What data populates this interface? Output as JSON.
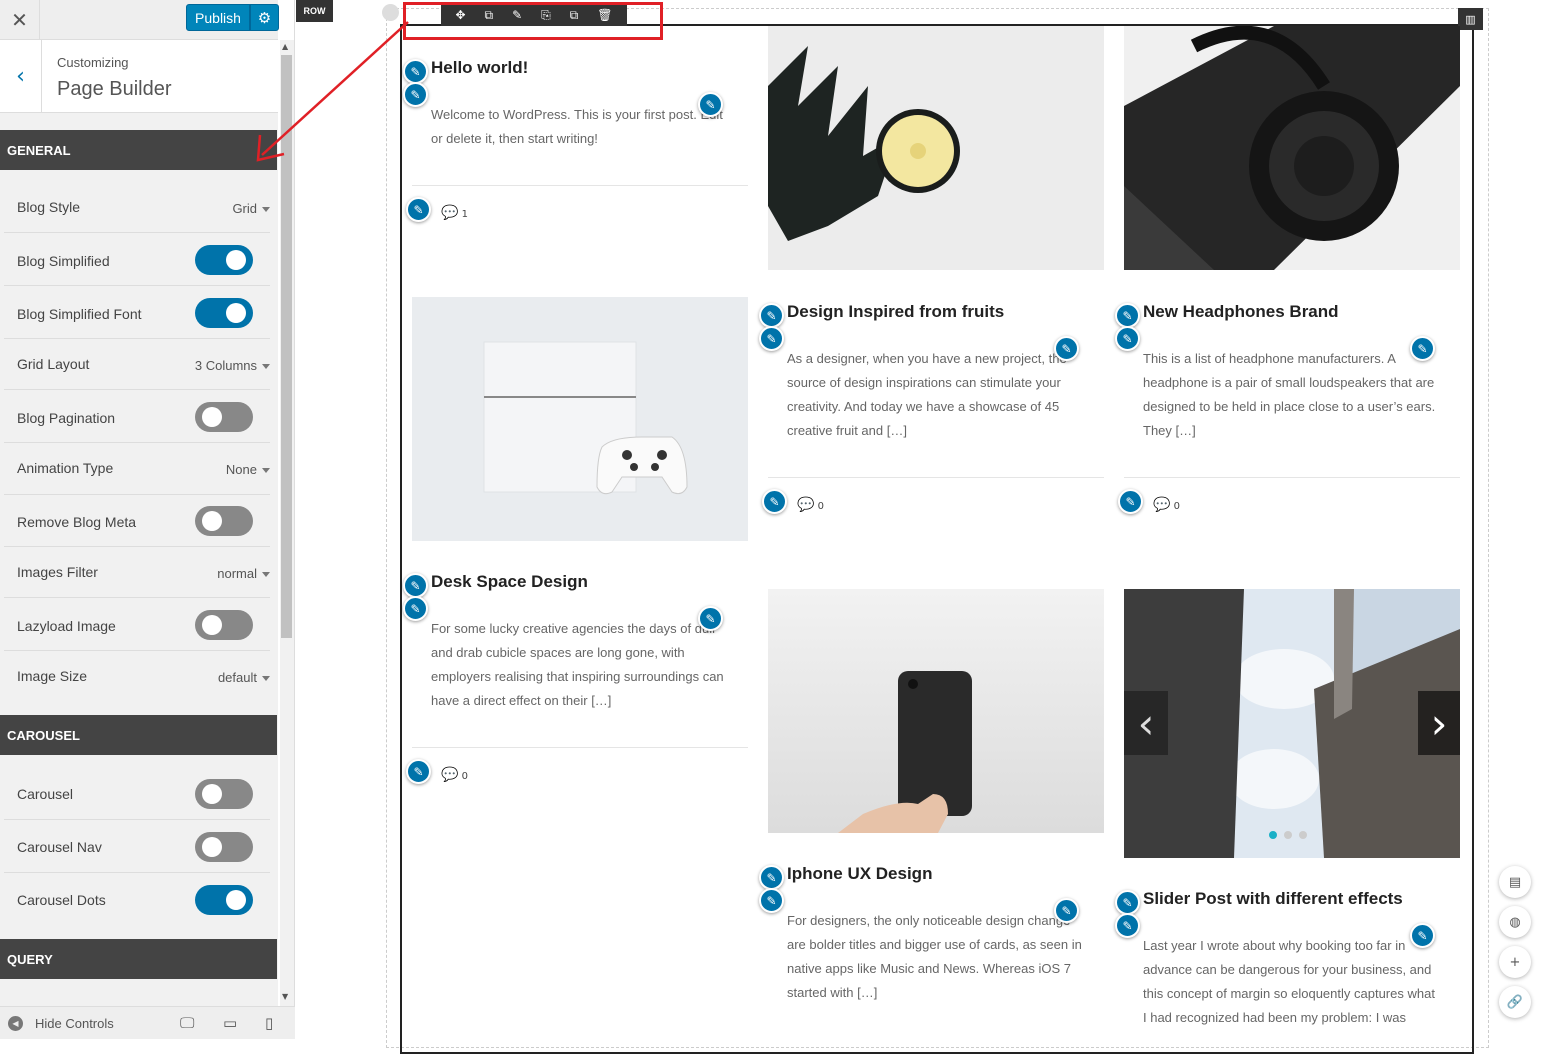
{
  "topbar": {
    "close_icon": "✕",
    "publish_label": "Publish",
    "settings_icon": "⚙"
  },
  "header": {
    "back_icon": "‹",
    "breadcrumb": "Customizing",
    "title": "Page Builder"
  },
  "sections": {
    "general": "GENERAL",
    "carousel": "CAROUSEL",
    "query": "QUERY"
  },
  "general_controls": {
    "blog_style": {
      "label": "Blog Style",
      "value": "Grid"
    },
    "blog_simplified": {
      "label": "Blog Simplified",
      "on": true
    },
    "blog_simplified_font": {
      "label": "Blog Simplified Font",
      "on": true
    },
    "grid_layout": {
      "label": "Grid Layout",
      "value": "3 Columns"
    },
    "blog_pagination": {
      "label": "Blog Pagination",
      "on": false
    },
    "animation_type": {
      "label": "Animation Type",
      "value": "None"
    },
    "remove_blog_meta": {
      "label": "Remove Blog Meta",
      "on": false
    },
    "images_filter": {
      "label": "Images Filter",
      "value": "normal"
    },
    "lazyload_image": {
      "label": "Lazyload Image",
      "on": false
    },
    "image_size": {
      "label": "Image Size",
      "value": "default"
    }
  },
  "carousel_controls": {
    "carousel": {
      "label": "Carousel",
      "on": false
    },
    "carousel_nav": {
      "label": "Carousel Nav",
      "on": false
    },
    "carousel_dots": {
      "label": "Carousel Dots",
      "on": true
    }
  },
  "footer": {
    "hide_controls": "Hide Controls",
    "desktop_icon": "🖵",
    "tablet_icon": "▭",
    "mobile_icon": "▯"
  },
  "canvas": {
    "row_tag": "ROW",
    "toolbar_icons": [
      "✥",
      "⧉",
      "✎",
      "⎘",
      "⧉",
      "🗑"
    ],
    "column_icon": "▥"
  },
  "posts": [
    {
      "title": "Hello world!",
      "excerpt": "Welcome to WordPress. This is your first post. Edit or delete it, then start writing!",
      "comments": "1"
    },
    {
      "title": "Design Inspired from fruits",
      "excerpt": "As a designer, when you have a new project, the source of design inspirations can stimulate your creativity. And today we have a showcase of 45 creative fruit and […]",
      "comments": "0"
    },
    {
      "title": "New Headphones Brand",
      "excerpt": "This is a list of headphone manufacturers. A headphone is a pair of small loudspeakers that are designed to be held in place close to a user’s ears. They […]",
      "comments": "0"
    },
    {
      "title": "Desk Space Design",
      "excerpt": "For some lucky creative agencies the days of dull and drab cubicle spaces are long gone, with employers realising that inspiring surroundings can have a direct effect on their […]",
      "comments": "0"
    },
    {
      "title": "Iphone UX Design",
      "excerpt": "For designers, the only noticeable design change are bolder titles and bigger use of cards, as seen in native apps like Music and News. Whereas iOS 7 started with […]"
    },
    {
      "title": "Slider Post with different effects",
      "excerpt": "Last year I wrote about why booking too far in advance can be dangerous for your business, and this concept of margin so eloquently captures what I had recognized had been my problem: I was"
    }
  ],
  "icons": {
    "pencil": "✎",
    "comment": "💬",
    "prev": "‹",
    "next": "›"
  },
  "fabs": [
    "▤",
    "◍",
    "+",
    "🔗"
  ],
  "colors": {
    "accent": "#0073aa",
    "section_bg": "#444444",
    "annotation": "#e02026"
  }
}
